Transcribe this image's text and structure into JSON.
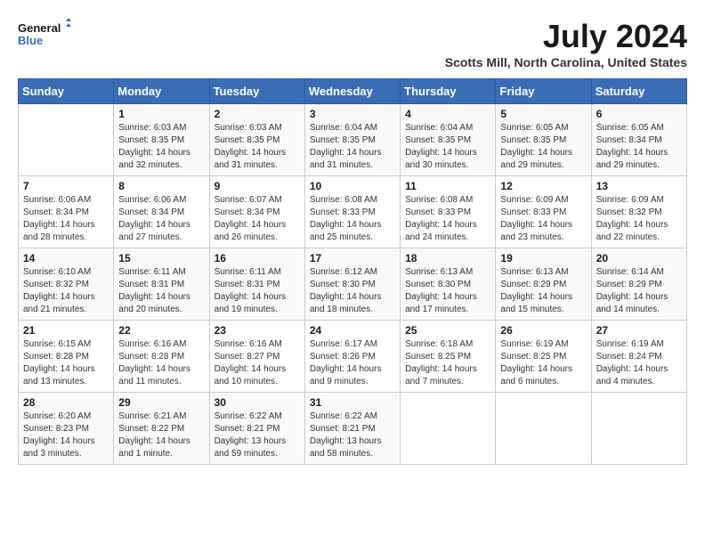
{
  "logo": {
    "line1": "General",
    "line2": "Blue"
  },
  "title": "July 2024",
  "location": "Scotts Mill, North Carolina, United States",
  "days_header": [
    "Sunday",
    "Monday",
    "Tuesday",
    "Wednesday",
    "Thursday",
    "Friday",
    "Saturday"
  ],
  "weeks": [
    [
      {
        "num": "",
        "info": ""
      },
      {
        "num": "1",
        "info": "Sunrise: 6:03 AM\nSunset: 8:35 PM\nDaylight: 14 hours\nand 32 minutes."
      },
      {
        "num": "2",
        "info": "Sunrise: 6:03 AM\nSunset: 8:35 PM\nDaylight: 14 hours\nand 31 minutes."
      },
      {
        "num": "3",
        "info": "Sunrise: 6:04 AM\nSunset: 8:35 PM\nDaylight: 14 hours\nand 31 minutes."
      },
      {
        "num": "4",
        "info": "Sunrise: 6:04 AM\nSunset: 8:35 PM\nDaylight: 14 hours\nand 30 minutes."
      },
      {
        "num": "5",
        "info": "Sunrise: 6:05 AM\nSunset: 8:35 PM\nDaylight: 14 hours\nand 29 minutes."
      },
      {
        "num": "6",
        "info": "Sunrise: 6:05 AM\nSunset: 8:34 PM\nDaylight: 14 hours\nand 29 minutes."
      }
    ],
    [
      {
        "num": "7",
        "info": "Sunrise: 6:06 AM\nSunset: 8:34 PM\nDaylight: 14 hours\nand 28 minutes."
      },
      {
        "num": "8",
        "info": "Sunrise: 6:06 AM\nSunset: 8:34 PM\nDaylight: 14 hours\nand 27 minutes."
      },
      {
        "num": "9",
        "info": "Sunrise: 6:07 AM\nSunset: 8:34 PM\nDaylight: 14 hours\nand 26 minutes."
      },
      {
        "num": "10",
        "info": "Sunrise: 6:08 AM\nSunset: 8:33 PM\nDaylight: 14 hours\nand 25 minutes."
      },
      {
        "num": "11",
        "info": "Sunrise: 6:08 AM\nSunset: 8:33 PM\nDaylight: 14 hours\nand 24 minutes."
      },
      {
        "num": "12",
        "info": "Sunrise: 6:09 AM\nSunset: 8:33 PM\nDaylight: 14 hours\nand 23 minutes."
      },
      {
        "num": "13",
        "info": "Sunrise: 6:09 AM\nSunset: 8:32 PM\nDaylight: 14 hours\nand 22 minutes."
      }
    ],
    [
      {
        "num": "14",
        "info": "Sunrise: 6:10 AM\nSunset: 8:32 PM\nDaylight: 14 hours\nand 21 minutes."
      },
      {
        "num": "15",
        "info": "Sunrise: 6:11 AM\nSunset: 8:31 PM\nDaylight: 14 hours\nand 20 minutes."
      },
      {
        "num": "16",
        "info": "Sunrise: 6:11 AM\nSunset: 8:31 PM\nDaylight: 14 hours\nand 19 minutes."
      },
      {
        "num": "17",
        "info": "Sunrise: 6:12 AM\nSunset: 8:30 PM\nDaylight: 14 hours\nand 18 minutes."
      },
      {
        "num": "18",
        "info": "Sunrise: 6:13 AM\nSunset: 8:30 PM\nDaylight: 14 hours\nand 17 minutes."
      },
      {
        "num": "19",
        "info": "Sunrise: 6:13 AM\nSunset: 8:29 PM\nDaylight: 14 hours\nand 15 minutes."
      },
      {
        "num": "20",
        "info": "Sunrise: 6:14 AM\nSunset: 8:29 PM\nDaylight: 14 hours\nand 14 minutes."
      }
    ],
    [
      {
        "num": "21",
        "info": "Sunrise: 6:15 AM\nSunset: 8:28 PM\nDaylight: 14 hours\nand 13 minutes."
      },
      {
        "num": "22",
        "info": "Sunrise: 6:16 AM\nSunset: 8:28 PM\nDaylight: 14 hours\nand 11 minutes."
      },
      {
        "num": "23",
        "info": "Sunrise: 6:16 AM\nSunset: 8:27 PM\nDaylight: 14 hours\nand 10 minutes."
      },
      {
        "num": "24",
        "info": "Sunrise: 6:17 AM\nSunset: 8:26 PM\nDaylight: 14 hours\nand 9 minutes."
      },
      {
        "num": "25",
        "info": "Sunrise: 6:18 AM\nSunset: 8:25 PM\nDaylight: 14 hours\nand 7 minutes."
      },
      {
        "num": "26",
        "info": "Sunrise: 6:19 AM\nSunset: 8:25 PM\nDaylight: 14 hours\nand 6 minutes."
      },
      {
        "num": "27",
        "info": "Sunrise: 6:19 AM\nSunset: 8:24 PM\nDaylight: 14 hours\nand 4 minutes."
      }
    ],
    [
      {
        "num": "28",
        "info": "Sunrise: 6:20 AM\nSunset: 8:23 PM\nDaylight: 14 hours\nand 3 minutes."
      },
      {
        "num": "29",
        "info": "Sunrise: 6:21 AM\nSunset: 8:22 PM\nDaylight: 14 hours\nand 1 minute."
      },
      {
        "num": "30",
        "info": "Sunrise: 6:22 AM\nSunset: 8:21 PM\nDaylight: 13 hours\nand 59 minutes."
      },
      {
        "num": "31",
        "info": "Sunrise: 6:22 AM\nSunset: 8:21 PM\nDaylight: 13 hours\nand 58 minutes."
      },
      {
        "num": "",
        "info": ""
      },
      {
        "num": "",
        "info": ""
      },
      {
        "num": "",
        "info": ""
      }
    ]
  ]
}
